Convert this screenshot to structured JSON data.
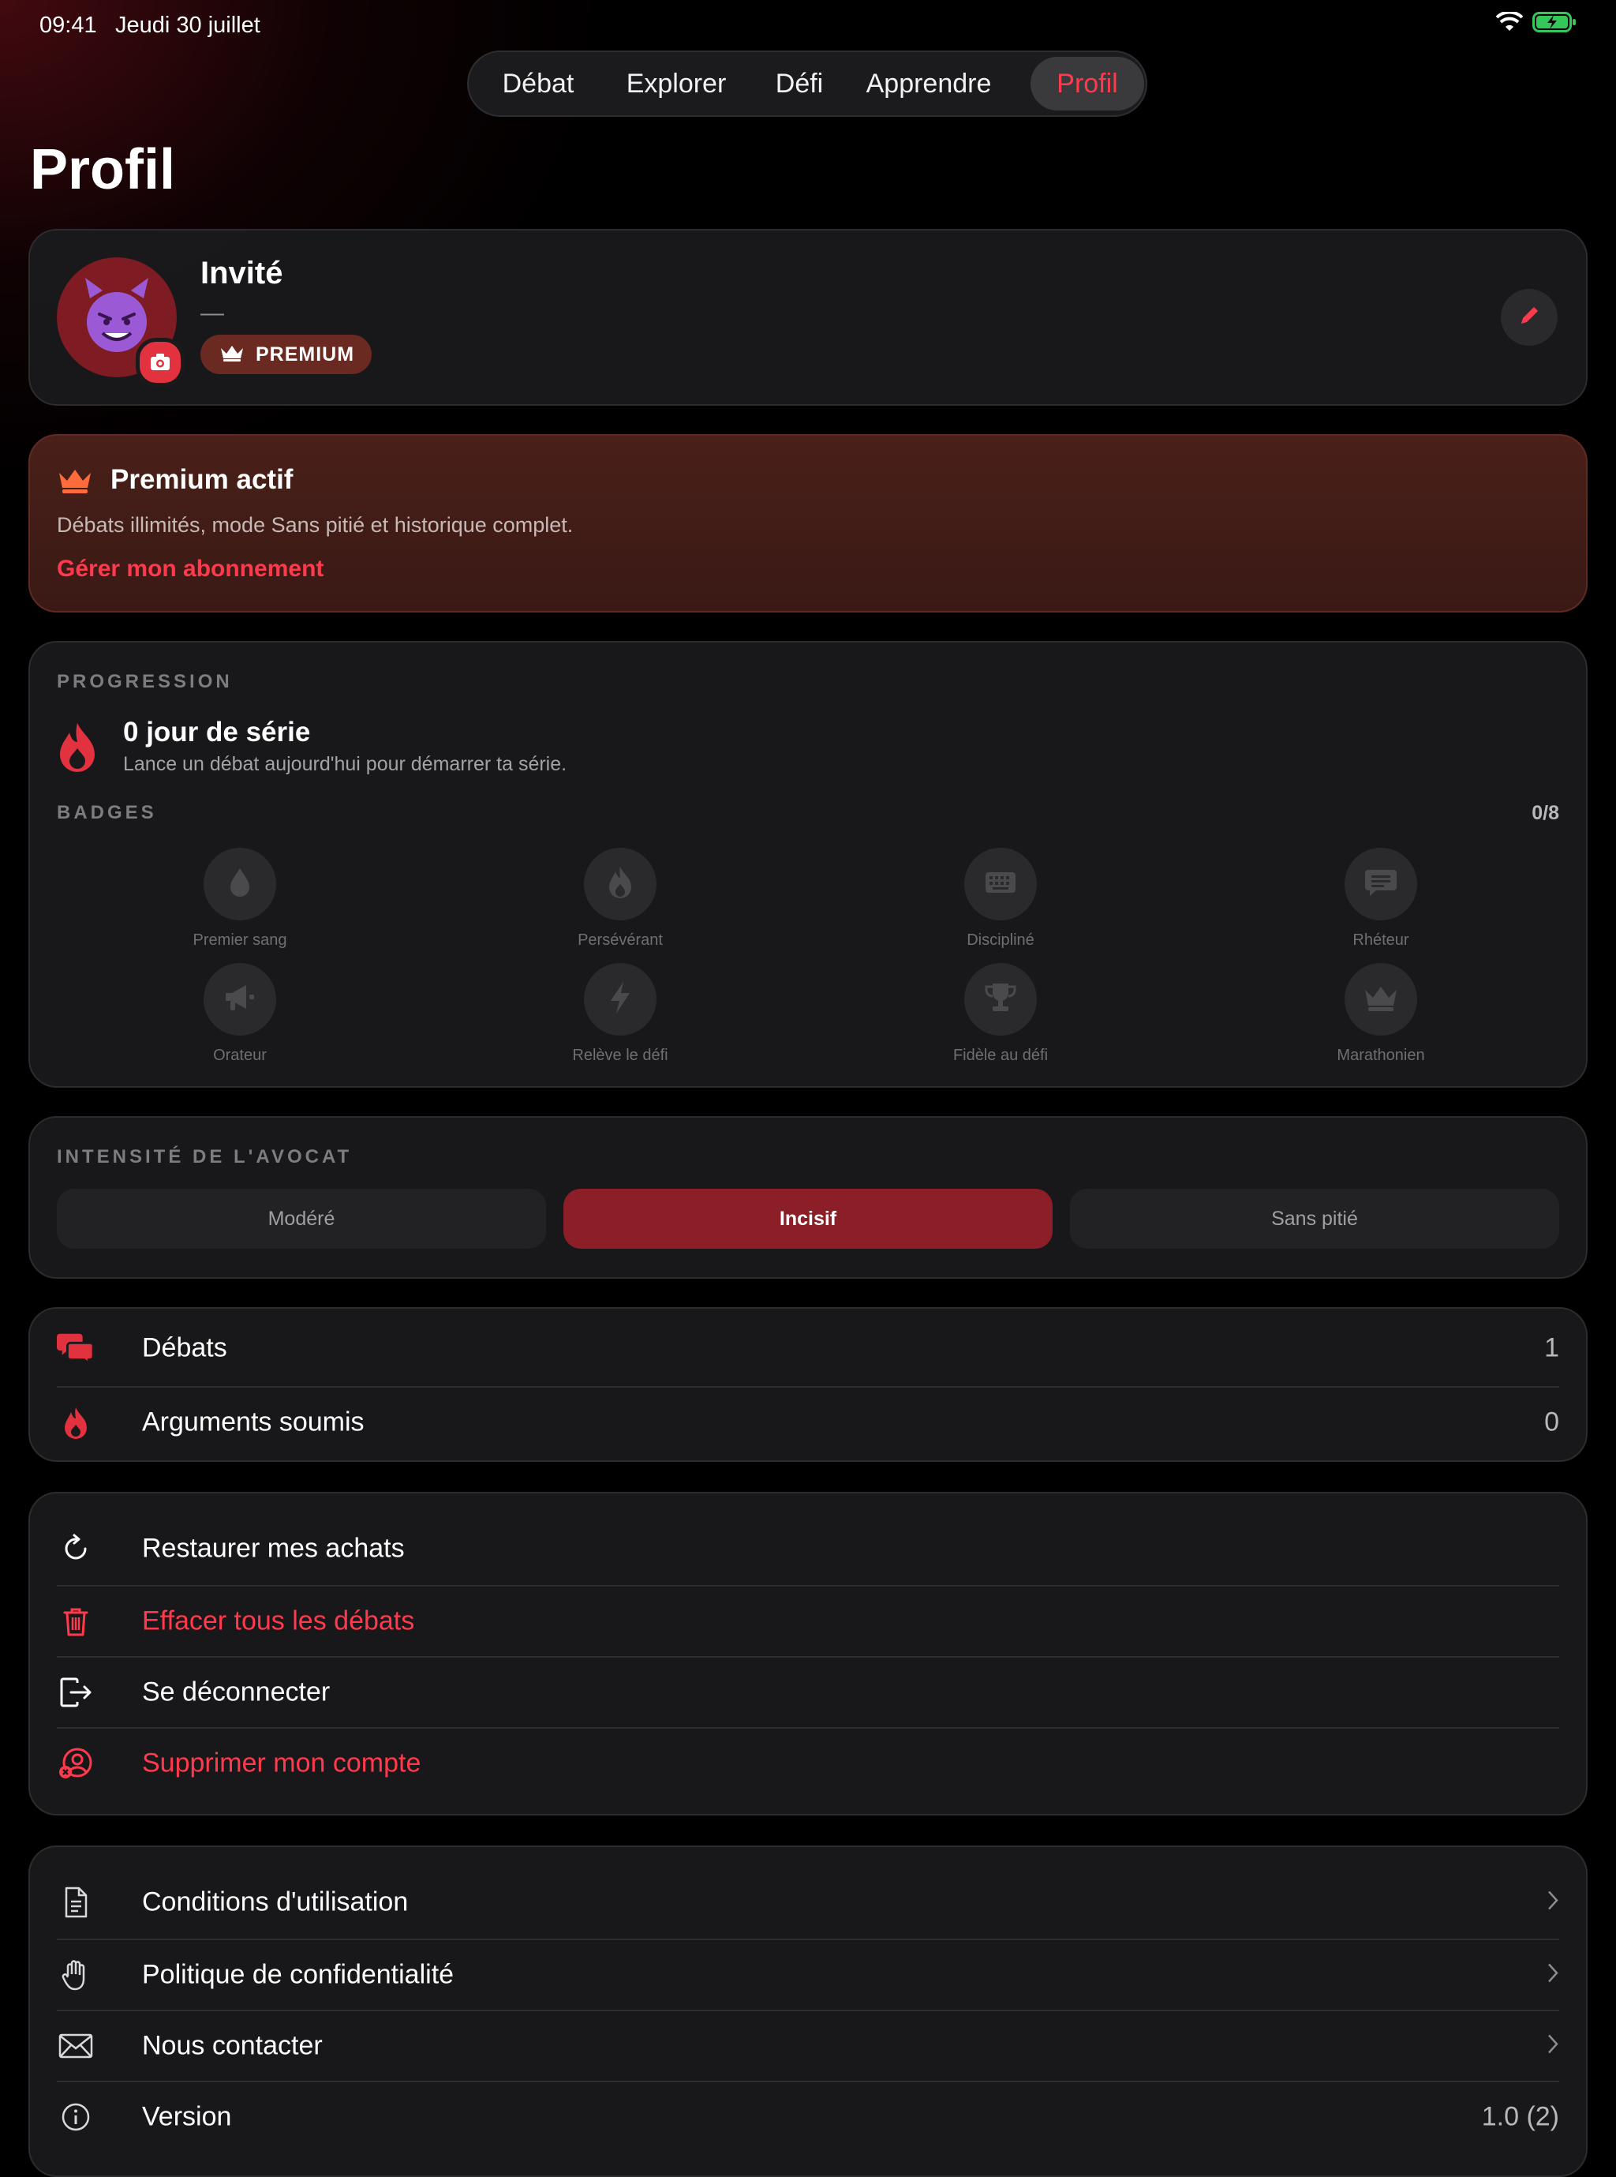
{
  "status": {
    "time": "09:41",
    "date": "Jeudi 30 juillet",
    "wifi_icon": "wifi-icon",
    "battery_icon": "battery-charging-icon",
    "battery_color": "#34c759"
  },
  "tabs": [
    {
      "label": "Débat",
      "active": false
    },
    {
      "label": "Explorer",
      "active": false
    },
    {
      "label": "Défi",
      "active": false
    },
    {
      "label": "Apprendre",
      "active": false
    },
    {
      "label": "Profil",
      "active": true
    }
  ],
  "page_title": "Profil",
  "profile": {
    "name": "Invité",
    "subtitle": "—",
    "badge": "PREMIUM",
    "avatar_icon": "smiling-devil-icon"
  },
  "premium": {
    "title": "Premium actif",
    "description": "Débats illimités, mode Sans pitié et historique complet.",
    "link": "Gérer mon abonnement"
  },
  "progression": {
    "section_label": "PROGRESSION",
    "streak_title": "0 jour de série",
    "streak_subtitle": "Lance un débat aujourd'hui pour démarrer ta série.",
    "badges_label": "BADGES",
    "badges_count": "0/8",
    "badges": [
      {
        "label": "Premier sang",
        "icon": "drop-icon"
      },
      {
        "label": "Persévérant",
        "icon": "flame-icon"
      },
      {
        "label": "Discipliné",
        "icon": "keyboard-icon"
      },
      {
        "label": "Rhéteur",
        "icon": "speech-bubble-icon"
      },
      {
        "label": "Orateur",
        "icon": "megaphone-icon"
      },
      {
        "label": "Relève le défi",
        "icon": "bolt-icon"
      },
      {
        "label": "Fidèle au défi",
        "icon": "trophy-icon"
      },
      {
        "label": "Marathonien",
        "icon": "crown-icon"
      }
    ]
  },
  "intensity": {
    "section_label": "INTENSITÉ DE L'AVOCAT",
    "options": [
      "Modéré",
      "Incisif",
      "Sans pitié"
    ],
    "selected": "Incisif"
  },
  "stats": [
    {
      "label": "Débats",
      "value": "1",
      "icon": "chat-bubbles-icon"
    },
    {
      "label": "Arguments soumis",
      "value": "0",
      "icon": "flame-icon"
    }
  ],
  "actions": [
    {
      "label": "Restaurer mes achats",
      "icon": "restore-icon",
      "danger": false
    },
    {
      "label": "Effacer tous les débats",
      "icon": "trash-icon",
      "danger": true
    },
    {
      "label": "Se déconnecter",
      "icon": "logout-icon",
      "danger": false
    },
    {
      "label": "Supprimer mon compte",
      "icon": "delete-account-icon",
      "danger": true
    }
  ],
  "info": [
    {
      "label": "Conditions d'utilisation",
      "icon": "document-icon"
    },
    {
      "label": "Politique de confidentialité",
      "icon": "hand-icon"
    },
    {
      "label": "Nous contacter",
      "icon": "envelope-icon"
    },
    {
      "label": "Version",
      "icon": "info-icon",
      "value": "1.0 (2)"
    }
  ],
  "colors": {
    "accent": "#ff3a4c",
    "background": "#000000",
    "card": "#1a1a1c",
    "selected_segment": "#8b1e26"
  }
}
